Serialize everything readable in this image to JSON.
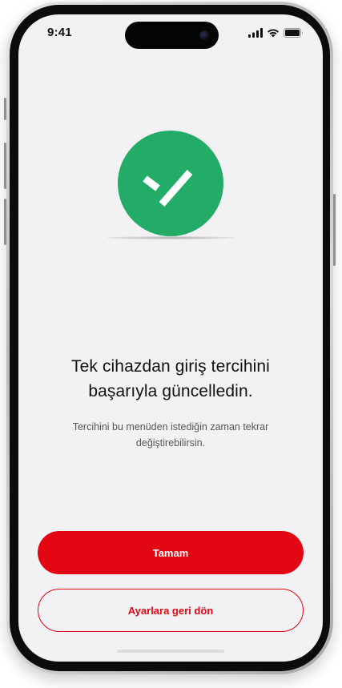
{
  "status_bar": {
    "time": "9:41",
    "icons": [
      "signal-icon",
      "wifi-icon",
      "battery-icon"
    ]
  },
  "success": {
    "icon": "checkmark-icon",
    "color": "#23ab68"
  },
  "content": {
    "title_line1": "Tek cihazdan giriş tercihini",
    "title_line2": "başarıyla güncelledin.",
    "subtitle_line1": "Tercihini bu menüden istediğin zaman tekrar",
    "subtitle_line2": "değiştirebilirsin."
  },
  "actions": {
    "primary_label": "Tamam",
    "secondary_label": "Ayarlara geri dön",
    "accent_color": "#e30613"
  }
}
